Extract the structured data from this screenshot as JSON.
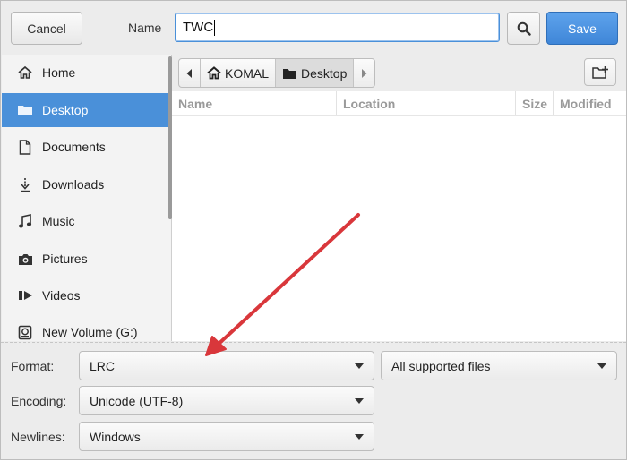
{
  "header": {
    "cancel_label": "Cancel",
    "name_label": "Name",
    "name_value": "TWC",
    "search_icon": "search-icon",
    "save_label": "Save"
  },
  "sidebar": {
    "items": [
      {
        "label": "Home",
        "icon": "home-icon"
      },
      {
        "label": "Desktop",
        "icon": "folder-icon",
        "active": true
      },
      {
        "label": "Documents",
        "icon": "document-icon"
      },
      {
        "label": "Downloads",
        "icon": "download-icon"
      },
      {
        "label": "Music",
        "icon": "music-icon"
      },
      {
        "label": "Pictures",
        "icon": "camera-icon"
      },
      {
        "label": "Videos",
        "icon": "video-icon"
      },
      {
        "label": "New Volume (G:)",
        "icon": "drive-icon"
      }
    ]
  },
  "pathbar": {
    "segments": [
      {
        "label": "KOMAL",
        "icon": "home-icon"
      },
      {
        "label": "Desktop",
        "icon": "folder-icon",
        "active": true
      }
    ]
  },
  "filelist": {
    "columns": [
      "Name",
      "Location",
      "Size",
      "Modified"
    ]
  },
  "options": {
    "format_label": "Format:",
    "format_value": "LRC",
    "filter_value": "All supported files",
    "encoding_label": "Encoding:",
    "encoding_value": "Unicode (UTF-8)",
    "newlines_label": "Newlines:",
    "newlines_value": "Windows"
  },
  "colors": {
    "accent": "#4a90d9",
    "annotation_arrow": "#d9373b"
  }
}
